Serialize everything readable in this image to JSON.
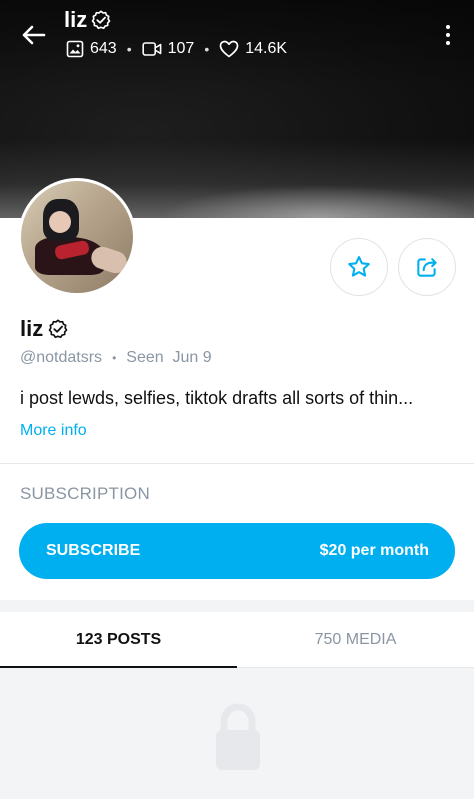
{
  "header": {
    "name": "liz",
    "stats": {
      "images": "643",
      "videos": "107",
      "likes": "14.6K"
    }
  },
  "profile": {
    "name": "liz",
    "handle": "@notdatsrs",
    "seen": "Seen  Jun 9",
    "bio": "i post lewds, selfies, tiktok drafts all sorts of thin...",
    "more_info": "More info"
  },
  "subscription": {
    "heading": "SUBSCRIPTION",
    "button_label": "SUBSCRIBE",
    "price": "$20 per month"
  },
  "tabs": [
    {
      "label": "123 POSTS",
      "active": true
    },
    {
      "label": "750 MEDIA",
      "active": false
    }
  ],
  "colors": {
    "accent": "#00aff0",
    "muted": "#8a96a3"
  },
  "icons": {
    "back": "arrow-left-icon",
    "verified": "verified-badge-icon",
    "images": "image-icon",
    "videos": "video-icon",
    "likes": "heart-icon",
    "more": "more-vertical-icon",
    "favorite": "star-icon",
    "share": "share-icon",
    "locked": "lock-icon"
  }
}
